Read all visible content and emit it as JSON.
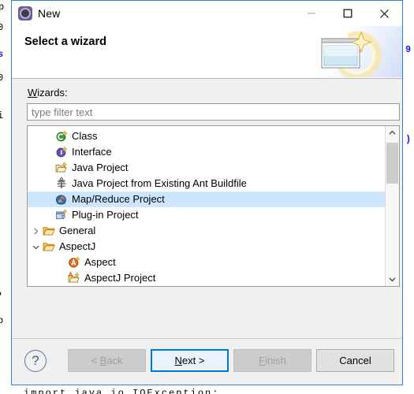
{
  "window": {
    "title": "New",
    "icon": "eclipse-wizard-icon",
    "controls": [
      {
        "name": "minimize-button",
        "glyph": "minimize-icon",
        "enabled": false
      },
      {
        "name": "maximize-button",
        "glyph": "maximize-icon",
        "enabled": true
      },
      {
        "name": "close-button",
        "glyph": "close-icon",
        "enabled": true
      }
    ]
  },
  "header": {
    "title": "Select a wizard",
    "banner_icon": "new-wizard-sparkle-banner"
  },
  "form": {
    "wizards_label": "Wizards:",
    "wizards_label_mnemonic": "W",
    "filter_value": "",
    "filter_placeholder": "type filter text"
  },
  "tree": {
    "items": [
      {
        "label": "Class",
        "icon": "java-class-icon",
        "indent": 1,
        "twisty": "none",
        "selected": false
      },
      {
        "label": "Interface",
        "icon": "java-interface-icon",
        "indent": 1,
        "twisty": "none",
        "selected": false
      },
      {
        "label": "Java Project",
        "icon": "java-project-icon",
        "indent": 1,
        "twisty": "none",
        "selected": false
      },
      {
        "label": "Java Project from Existing Ant Buildfile",
        "icon": "ant-buildfile-icon",
        "indent": 1,
        "twisty": "none",
        "selected": false
      },
      {
        "label": "Map/Reduce Project",
        "icon": "mapreduce-project-icon",
        "indent": 1,
        "twisty": "none",
        "selected": true
      },
      {
        "label": "Plug-in Project",
        "icon": "plugin-project-icon",
        "indent": 1,
        "twisty": "none",
        "selected": false
      },
      {
        "label": "General",
        "icon": "folder-icon",
        "indent": 0,
        "twisty": "collapsed",
        "selected": false
      },
      {
        "label": "AspectJ",
        "icon": "folder-icon",
        "indent": 0,
        "twisty": "expanded",
        "selected": false
      },
      {
        "label": "Aspect",
        "icon": "aspect-icon",
        "indent": 2,
        "twisty": "none",
        "selected": false
      },
      {
        "label": "AspectJ Project",
        "icon": "aspectj-project-icon",
        "indent": 2,
        "twisty": "none",
        "selected": false
      }
    ],
    "scrollbar": {
      "up_arrow": "chevron-up-icon",
      "down_arrow": "chevron-down-icon",
      "thumb_position": "near-top"
    }
  },
  "footer": {
    "help_label": "?",
    "buttons": [
      {
        "name": "back-button",
        "label": "< Back",
        "mnemonic": "B",
        "state": "disabled"
      },
      {
        "name": "next-button",
        "label": "Next >",
        "mnemonic": "N",
        "state": "default"
      },
      {
        "name": "finish-button",
        "label": "Finish",
        "mnemonic": "F",
        "state": "disabled"
      },
      {
        "name": "cancel-button",
        "label": "Cancel",
        "mnemonic": "",
        "state": "enabled"
      }
    ]
  },
  "colors": {
    "dialog_border": "#3a7fd5",
    "selection": "#cde6ff",
    "default_button_border": "#0078d7",
    "panel_bg": "#f0f0f0"
  }
}
